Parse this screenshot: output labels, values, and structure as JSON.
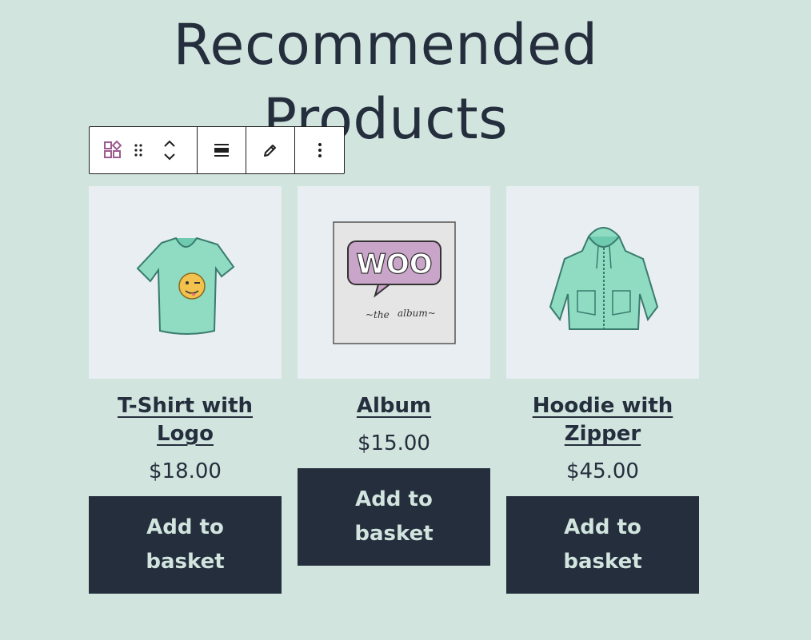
{
  "heading": {
    "title": "Recommended Products"
  },
  "toolbar": {
    "buttons": [
      {
        "icon": "block-grid-icon",
        "color": "#9b5c8f"
      },
      {
        "icon": "drag-handle-icon"
      },
      {
        "icon": "move-up-icon"
      },
      {
        "icon": "move-down-icon"
      },
      {
        "icon": "align-icon"
      },
      {
        "icon": "pencil-icon"
      },
      {
        "icon": "more-options-icon"
      }
    ]
  },
  "products": [
    {
      "name": "T-Shirt with Logo",
      "price": "$18.00",
      "button": "Add to basket"
    },
    {
      "name": "Album",
      "price": "$15.00",
      "button": "Add to basket"
    },
    {
      "name": "Hoodie with Zipper",
      "price": "$45.00",
      "button": "Add to basket"
    }
  ],
  "colors": {
    "background": "#d1e4de",
    "text": "#252e3d",
    "button_bg": "#252e3d",
    "button_text": "#d1e4de",
    "image_bg": "#e8eef1"
  }
}
